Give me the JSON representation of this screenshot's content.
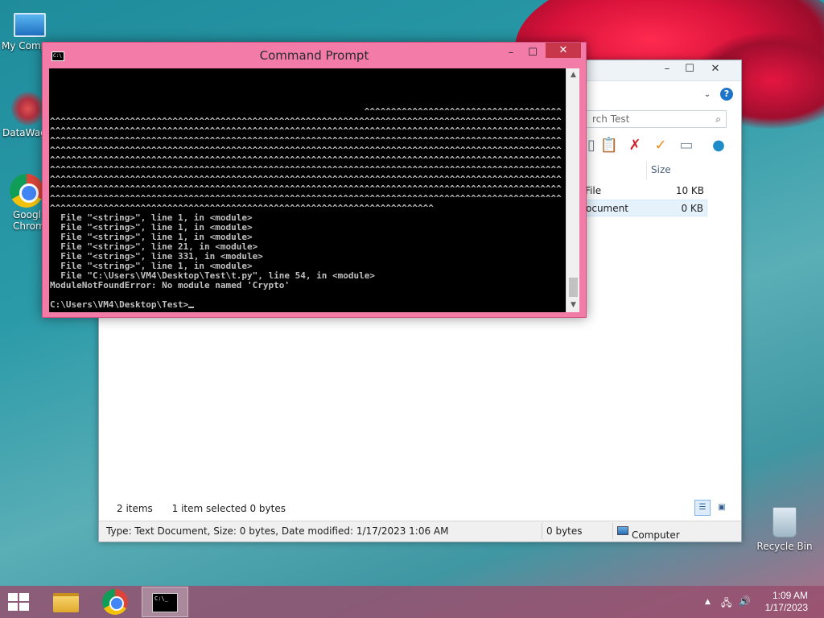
{
  "desktop": {
    "icons": [
      {
        "label": "My Comp"
      },
      {
        "label": "DataWag"
      },
      {
        "label": "Googl Chrom"
      },
      {
        "label": "Recycle Bin"
      }
    ]
  },
  "explorer": {
    "search_placeholder": "rch Test",
    "column_size": "Size",
    "files": [
      {
        "name": "File",
        "size": "10 KB"
      },
      {
        "name": "ocument",
        "size": "0 KB"
      }
    ],
    "status_items": "2 items",
    "status_selected": "1 item selected  0 bytes",
    "detail_type": "Type: Text Document, Size: 0 bytes, Date modified: 1/17/2023 1:06 AM",
    "detail_bytes": "0 bytes",
    "detail_location": "Computer"
  },
  "cmd": {
    "title": "Command Prompt",
    "lines": [
      "",
      "",
      "",
      "",
      "                                                           ^^^^^^^^^^^^^^^^^^^^^^^^^^^^^^^^^^^^^",
      "^^^^^^^^^^^^^^^^^^^^^^^^^^^^^^^^^^^^^^^^^^^^^^^^^^^^^^^^^^^^^^^^^^^^^^^^^^^^^^^^^^^^^^^^^^^^^^^^",
      "^^^^^^^^^^^^^^^^^^^^^^^^^^^^^^^^^^^^^^^^^^^^^^^^^^^^^^^^^^^^^^^^^^^^^^^^^^^^^^^^^^^^^^^^^^^^^^^^",
      "^^^^^^^^^^^^^^^^^^^^^^^^^^^^^^^^^^^^^^^^^^^^^^^^^^^^^^^^^^^^^^^^^^^^^^^^^^^^^^^^^^^^^^^^^^^^^^^^",
      "^^^^^^^^^^^^^^^^^^^^^^^^^^^^^^^^^^^^^^^^^^^^^^^^^^^^^^^^^^^^^^^^^^^^^^^^^^^^^^^^^^^^^^^^^^^^^^^^",
      "^^^^^^^^^^^^^^^^^^^^^^^^^^^^^^^^^^^^^^^^^^^^^^^^^^^^^^^^^^^^^^^^^^^^^^^^^^^^^^^^^^^^^^^^^^^^^^^^",
      "^^^^^^^^^^^^^^^^^^^^^^^^^^^^^^^^^^^^^^^^^^^^^^^^^^^^^^^^^^^^^^^^^^^^^^^^^^^^^^^^^^^^^^^^^^^^^^^^",
      "^^^^^^^^^^^^^^^^^^^^^^^^^^^^^^^^^^^^^^^^^^^^^^^^^^^^^^^^^^^^^^^^^^^^^^^^^^^^^^^^^^^^^^^^^^^^^^^^",
      "^^^^^^^^^^^^^^^^^^^^^^^^^^^^^^^^^^^^^^^^^^^^^^^^^^^^^^^^^^^^^^^^^^^^^^^^^^^^^^^^^^^^^^^^^^^^^^^^",
      "^^^^^^^^^^^^^^^^^^^^^^^^^^^^^^^^^^^^^^^^^^^^^^^^^^^^^^^^^^^^^^^^^^^^^^^^^^^^^^^^^^^^^^^^^^^^^^^^",
      "^^^^^^^^^^^^^^^^^^^^^^^^^^^^^^^^^^^^^^^^^^^^^^^^^^^^^^^^^^^^^^^^^^^^^^^^",
      "  File \"<string>\", line 1, in <module>",
      "  File \"<string>\", line 1, in <module>",
      "  File \"<string>\", line 1, in <module>",
      "  File \"<string>\", line 21, in <module>",
      "  File \"<string>\", line 331, in <module>",
      "  File \"<string>\", line 1, in <module>",
      "  File \"C:\\Users\\VM4\\Desktop\\Test\\t.py\", line 54, in <module>",
      "ModuleNotFoundError: No module named 'Crypto'",
      ""
    ],
    "prompt": "C:\\Users\\VM4\\Desktop\\Test>"
  },
  "taskbar": {
    "time": "1:09 AM",
    "date": "1/17/2023"
  }
}
